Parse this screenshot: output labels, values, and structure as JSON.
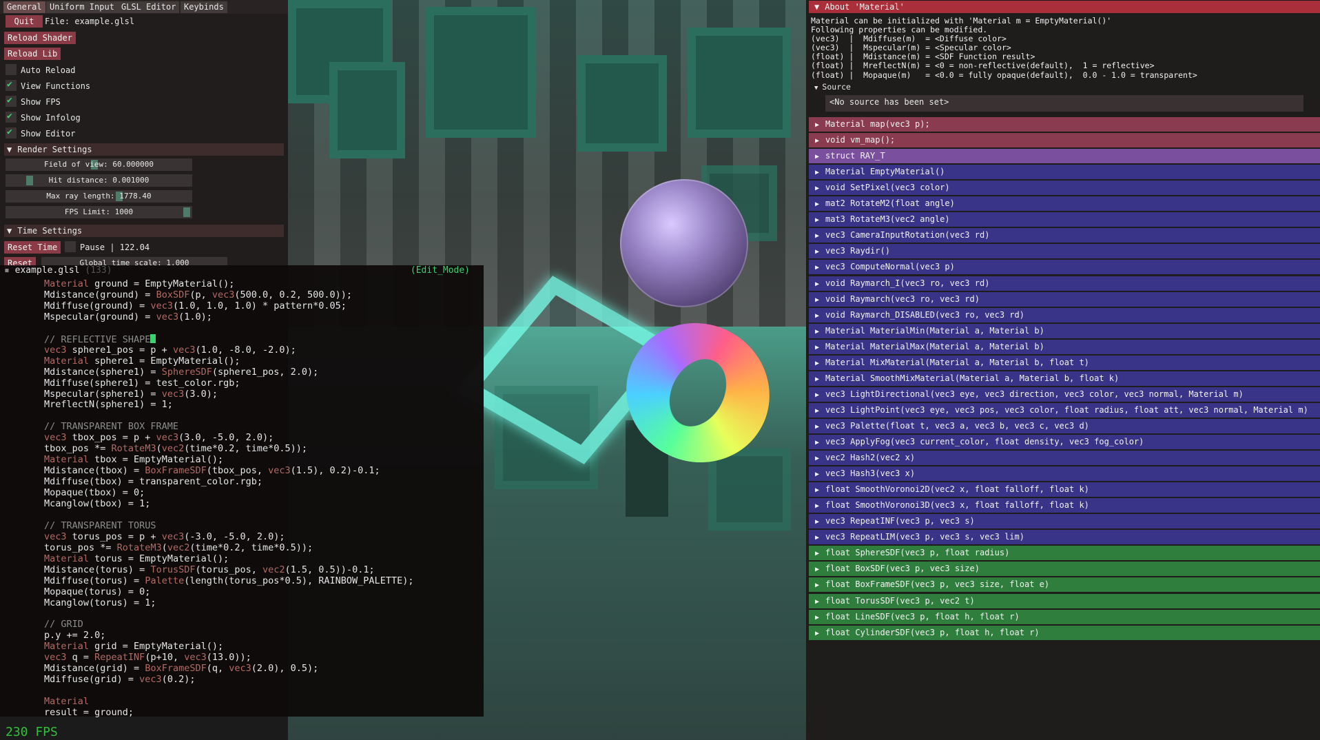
{
  "tabs": [
    "General",
    "Uniform Input",
    "GLSL Editor",
    "Keybinds"
  ],
  "general": {
    "quit_label": "Quit",
    "file_label": "File: example.glsl",
    "reload_shader": "Reload Shader",
    "reload_lib": "Reload Lib",
    "checkboxes": [
      {
        "label": "Auto Reload",
        "checked": false
      },
      {
        "label": "View Functions",
        "checked": true
      },
      {
        "label": "Show FPS",
        "checked": true
      },
      {
        "label": "Show Infolog",
        "checked": true
      },
      {
        "label": "Show Editor",
        "checked": true
      }
    ]
  },
  "render_settings": {
    "title": "Render Settings",
    "sliders": [
      {
        "label": "Field of view: 60.000000",
        "value": 60.0
      },
      {
        "label": "Hit distance: 0.001000",
        "value": 0.001
      },
      {
        "label": "Max ray length: 1778.40",
        "value": 1778.4
      },
      {
        "label": "FPS Limit: 1000",
        "value": 1000
      }
    ]
  },
  "time_settings": {
    "title": "Time Settings",
    "reset_time": "Reset Time",
    "pause_label": "Pause | 122.04",
    "reset_label": "Reset",
    "global_time_label": "Global time scale: 1.000"
  },
  "editor": {
    "filename": "example.glsl",
    "line_count": "(133)",
    "mode": "(Edit_Mode)",
    "lines": [
      [
        [
          "Material",
          "kw"
        ],
        [
          " ground = EmptyMaterial();",
          ""
        ]
      ],
      [
        [
          "Mdistance(ground) = ",
          ""
        ],
        [
          "BoxSDF",
          "kw"
        ],
        [
          "(p, ",
          ""
        ],
        [
          "vec3",
          "kw"
        ],
        [
          "(500.0, 0.2, 500.0));",
          ""
        ]
      ],
      [
        [
          "Mdiffuse(ground) = ",
          ""
        ],
        [
          "vec3",
          "kw"
        ],
        [
          "(1.0, 1.0, 1.0) * pattern*0.05;",
          ""
        ]
      ],
      [
        [
          "Mspecular(ground) = ",
          ""
        ],
        [
          "vec3",
          "kw"
        ],
        [
          "(1.0);",
          ""
        ]
      ],
      [],
      [
        [
          "// REFLECTIVE SHAPE",
          "cm"
        ]
      ],
      [
        [
          "vec3",
          "kw"
        ],
        [
          " sphere1_pos = p + ",
          ""
        ],
        [
          "vec3",
          "kw"
        ],
        [
          "(1.0, -8.0, -2.0);",
          ""
        ]
      ],
      [
        [
          "Material",
          "kw"
        ],
        [
          " sphere1 = EmptyMaterial();",
          ""
        ]
      ],
      [
        [
          "Mdistance(sphere1) = ",
          ""
        ],
        [
          "SphereSDF",
          "kw"
        ],
        [
          "(sphere1_pos, 2.0);",
          ""
        ]
      ],
      [
        [
          "Mdiffuse(sphere1) = test_color.rgb;",
          ""
        ]
      ],
      [
        [
          "Mspecular(sphere1) = ",
          ""
        ],
        [
          "vec3",
          "kw"
        ],
        [
          "(3.0);",
          ""
        ]
      ],
      [
        [
          "MreflectN(sphere1) = 1;",
          ""
        ]
      ],
      [],
      [
        [
          "// TRANSPARENT BOX FRAME",
          "cm"
        ]
      ],
      [
        [
          "vec3",
          "kw"
        ],
        [
          " tbox_pos = p + ",
          ""
        ],
        [
          "vec3",
          "kw"
        ],
        [
          "(3.0, -5.0, 2.0);",
          ""
        ]
      ],
      [
        [
          "tbox_pos *= ",
          ""
        ],
        [
          "RotateM3",
          "kw"
        ],
        [
          "(",
          ""
        ],
        [
          "vec2",
          "kw"
        ],
        [
          "(time*0.2, time*0.5));",
          ""
        ]
      ],
      [
        [
          "Material",
          "kw"
        ],
        [
          " tbox = EmptyMaterial();",
          ""
        ]
      ],
      [
        [
          "Mdistance(tbox) = ",
          ""
        ],
        [
          "BoxFrameSDF",
          "kw"
        ],
        [
          "(tbox_pos, ",
          ""
        ],
        [
          "vec3",
          "kw"
        ],
        [
          "(1.5), 0.2)-0.1;",
          ""
        ]
      ],
      [
        [
          "Mdiffuse(tbox) = transparent_color.rgb;",
          ""
        ]
      ],
      [
        [
          "Mopaque(tbox) = 0;",
          ""
        ]
      ],
      [
        [
          "Mcanglow(tbox) = 1;",
          ""
        ]
      ],
      [],
      [
        [
          "// TRANSPARENT TORUS",
          "cm"
        ]
      ],
      [
        [
          "vec3",
          "kw"
        ],
        [
          " torus_pos = p + ",
          ""
        ],
        [
          "vec3",
          "kw"
        ],
        [
          "(-3.0, -5.0, 2.0);",
          ""
        ]
      ],
      [
        [
          "torus_pos *= ",
          ""
        ],
        [
          "RotateM3",
          "kw"
        ],
        [
          "(",
          ""
        ],
        [
          "vec2",
          "kw"
        ],
        [
          "(time*0.2, time*0.5));",
          ""
        ]
      ],
      [
        [
          "Material",
          "kw"
        ],
        [
          " torus = EmptyMaterial();",
          ""
        ]
      ],
      [
        [
          "Mdistance(torus) = ",
          ""
        ],
        [
          "TorusSDF",
          "kw"
        ],
        [
          "(torus_pos, ",
          ""
        ],
        [
          "vec2",
          "kw"
        ],
        [
          "(1.5, 0.5))-0.1;",
          ""
        ]
      ],
      [
        [
          "Mdiffuse(torus) = ",
          ""
        ],
        [
          "Palette",
          "kw"
        ],
        [
          "(length(torus_pos*0.5), RAINBOW_PALETTE);",
          ""
        ]
      ],
      [
        [
          "Mopaque(torus) = 0;",
          ""
        ]
      ],
      [
        [
          "Mcanglow(torus) = 1;",
          ""
        ]
      ],
      [],
      [
        [
          "// GRID",
          "cm"
        ]
      ],
      [
        [
          "p.y += 2.0;",
          ""
        ]
      ],
      [
        [
          "Material",
          "kw"
        ],
        [
          " grid = EmptyMaterial();",
          ""
        ]
      ],
      [
        [
          "vec3",
          "kw"
        ],
        [
          " q = ",
          ""
        ],
        [
          "RepeatINF",
          "kw"
        ],
        [
          "(p+10, ",
          ""
        ],
        [
          "vec3",
          "kw"
        ],
        [
          "(13.0));",
          ""
        ]
      ],
      [
        [
          "Mdistance(grid) = ",
          ""
        ],
        [
          "BoxFrameSDF",
          "kw"
        ],
        [
          "(q, ",
          ""
        ],
        [
          "vec3",
          "kw"
        ],
        [
          "(2.0), 0.5);",
          ""
        ]
      ],
      [
        [
          "Mdiffuse(grid) = ",
          ""
        ],
        [
          "vec3",
          "kw"
        ],
        [
          "(0.2);",
          ""
        ]
      ],
      [],
      [
        [
          "Material",
          "kw"
        ]
      ],
      [
        [
          "result = ground;",
          ""
        ]
      ]
    ]
  },
  "fps_text": "230 FPS",
  "about": {
    "title": "About 'Material'",
    "text": "Material can be initialized with 'Material m = EmptyMaterial()'\nFollowing properties can be modified.\n(vec3)  |  Mdiffuse(m)  = <Diffuse color>\n(vec3)  |  Mspecular(m) = <Specular color>\n(float) |  Mdistance(m) = <SDF Function result>\n(float) |  MreflectN(m) = <0 = non-reflective(default),  1 = reflective>\n(float) |  Mopaque(m)   = <0.0 = fully opaque(default),  0.0 - 1.0 = transparent>",
    "source_label": "Source",
    "source_text": "<No source has been set>"
  },
  "colors": {
    "pink": "#8a3b4f",
    "struct": "#7a4f9e",
    "blue": "#3a3488",
    "green": "#2f7e3e"
  },
  "functions": [
    {
      "label": "Material map(vec3 p);",
      "color": "pink"
    },
    {
      "label": "void vm_map();",
      "color": "pink"
    },
    {
      "label": "struct RAY_T",
      "color": "struct"
    },
    {
      "label": "Material EmptyMaterial()",
      "color": "blue"
    },
    {
      "label": "void SetPixel(vec3 color)",
      "color": "blue"
    },
    {
      "label": "mat2 RotateM2(float angle)",
      "color": "blue"
    },
    {
      "label": "mat3 RotateM3(vec2 angle)",
      "color": "blue"
    },
    {
      "label": "vec3 CameraInputRotation(vec3 rd)",
      "color": "blue"
    },
    {
      "label": "vec3 Raydir()",
      "color": "blue"
    },
    {
      "label": "vec3 ComputeNormal(vec3 p)",
      "color": "blue"
    },
    {
      "label": "void Raymarch_I(vec3 ro, vec3 rd)",
      "color": "blue"
    },
    {
      "label": "void Raymarch(vec3 ro, vec3 rd)",
      "color": "blue"
    },
    {
      "label": "void Raymarch_DISABLED(vec3 ro, vec3 rd)",
      "color": "blue"
    },
    {
      "label": "Material MaterialMin(Material a, Material b)",
      "color": "blue"
    },
    {
      "label": "Material MaterialMax(Material a, Material b)",
      "color": "blue"
    },
    {
      "label": "Material MixMaterial(Material a, Material b, float t)",
      "color": "blue"
    },
    {
      "label": "Material SmoothMixMaterial(Material a, Material b, float k)",
      "color": "blue"
    },
    {
      "label": "vec3 LightDirectional(vec3 eye, vec3 direction, vec3 color, vec3 normal, Material m)",
      "color": "blue"
    },
    {
      "label": "vec3 LightPoint(vec3 eye, vec3 pos, vec3 color, float radius, float att, vec3 normal, Material m)",
      "color": "blue"
    },
    {
      "label": "vec3 Palette(float t, vec3 a, vec3 b, vec3 c, vec3 d)",
      "color": "blue"
    },
    {
      "label": "vec3 ApplyFog(vec3 current_color, float density, vec3 fog_color)",
      "color": "blue"
    },
    {
      "label": "vec2 Hash2(vec2 x)",
      "color": "blue"
    },
    {
      "label": "vec3 Hash3(vec3 x)",
      "color": "blue"
    },
    {
      "label": "float SmoothVoronoi2D(vec2 x, float falloff, float k)",
      "color": "blue"
    },
    {
      "label": "float SmoothVoronoi3D(vec3 x, float falloff, float k)",
      "color": "blue"
    },
    {
      "label": "vec3 RepeatINF(vec3 p, vec3 s)",
      "color": "blue"
    },
    {
      "label": "vec3 RepeatLIM(vec3 p, vec3 s, vec3 lim)",
      "color": "blue"
    },
    {
      "label": "float SphereSDF(vec3 p, float radius)",
      "color": "green"
    },
    {
      "label": "float BoxSDF(vec3 p, vec3 size)",
      "color": "green"
    },
    {
      "label": "float BoxFrameSDF(vec3 p, vec3 size, float e)",
      "color": "green"
    },
    {
      "label": "float TorusSDF(vec3 p, vec2 t)",
      "color": "green"
    },
    {
      "label": "float LineSDF(vec3 p, float h, float r)",
      "color": "green"
    },
    {
      "label": "float CylinderSDF(vec3 p, float h, float r)",
      "color": "green"
    }
  ]
}
